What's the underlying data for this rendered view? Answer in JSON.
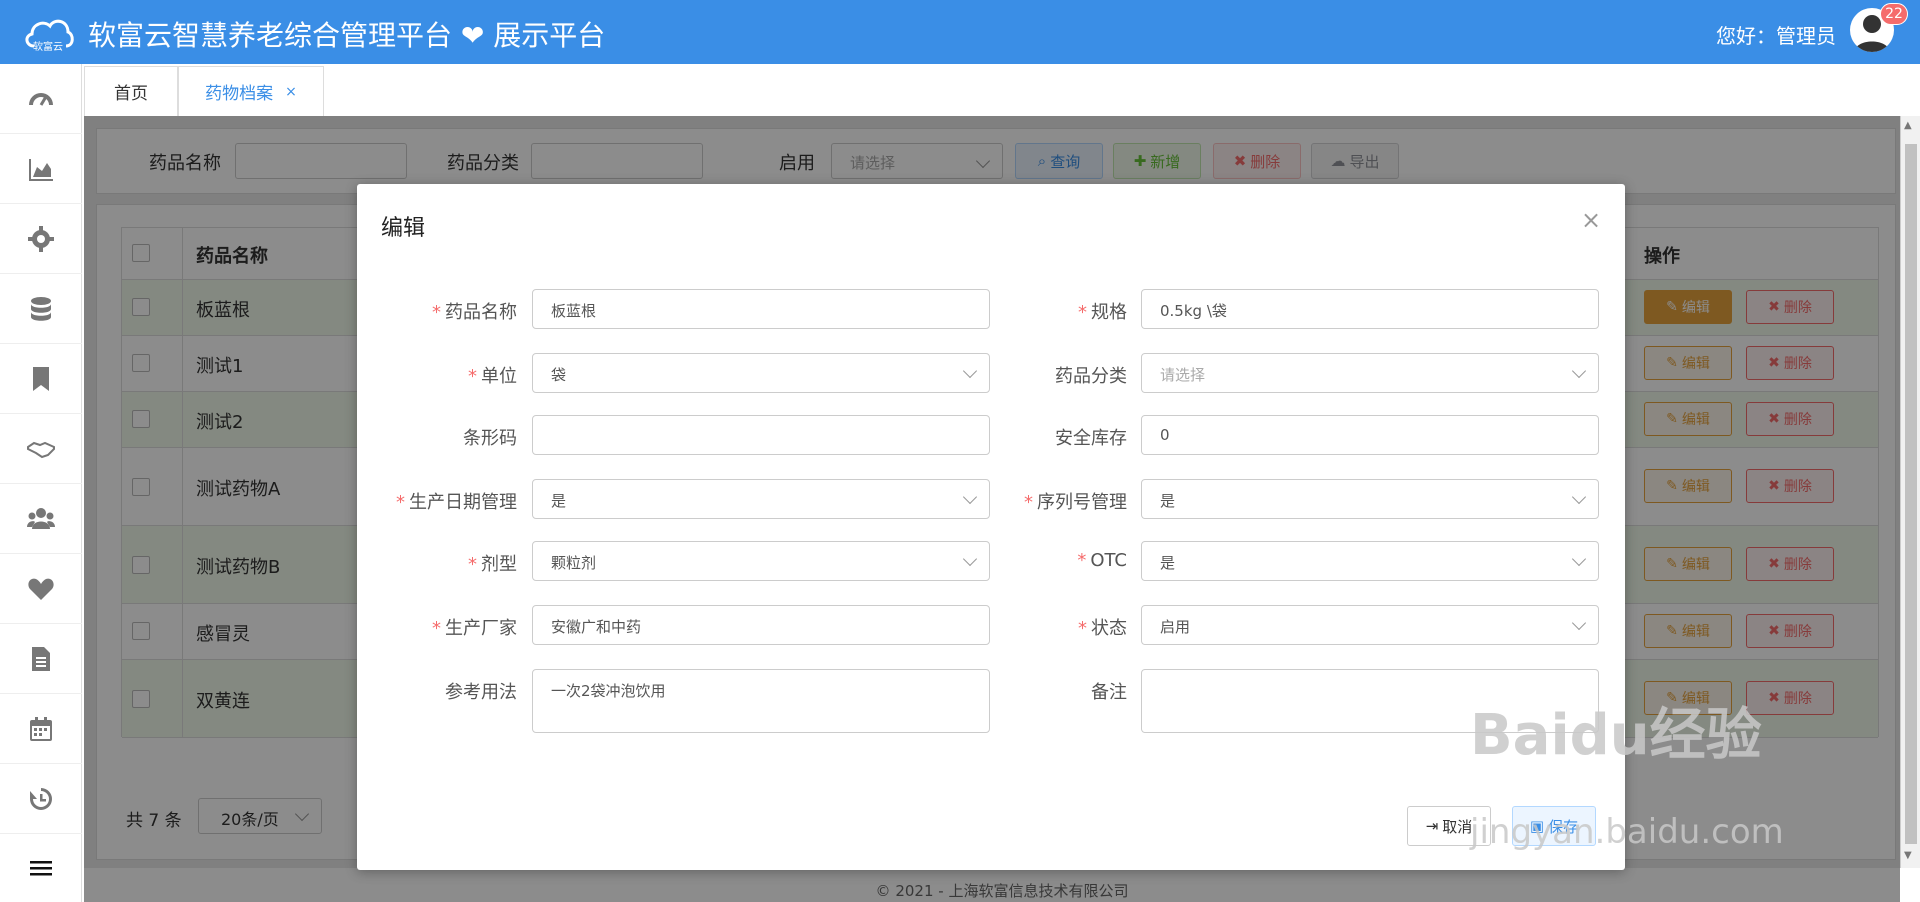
{
  "header": {
    "logo_text": "软富云",
    "title": "软富云智慧养老综合管理平台 ❤ 展示平台",
    "greeting": "您好：管理员",
    "badge": "22"
  },
  "sidebar": {
    "items": [
      "dashboard-icon",
      "chart-icon",
      "gear-icon",
      "database-icon",
      "bookmark-icon",
      "handshake-icon",
      "users-icon",
      "heart-icon",
      "document-icon",
      "calendar-icon",
      "history-icon",
      "menu-toggle-icon"
    ]
  },
  "tabs": [
    {
      "label": "首页"
    },
    {
      "label": "药物档案",
      "close": "×"
    }
  ],
  "search": {
    "name_label": "药品名称",
    "category_label": "药品分类",
    "enabled_label": "启用",
    "enabled_placeholder": "请选择",
    "query_btn": "查询",
    "add_btn": "新增",
    "delete_btn": "删除",
    "export_btn": "导出"
  },
  "table": {
    "header_name": "药品名称",
    "header_ops": "操作",
    "edit_label": "编辑",
    "delete_label": "删除",
    "rows": [
      "板蓝根",
      "测试1",
      "测试2",
      "测试药物A",
      "测试药物B",
      "感冒灵",
      "双黄连"
    ]
  },
  "pagination": {
    "total": "共 7 条",
    "page_size": "20条/页"
  },
  "footer": {
    "copyright": "© 2021 - 上海软富信息技术有限公司"
  },
  "modal": {
    "title": "编辑",
    "close": "×",
    "fields": {
      "drug_name": {
        "label": "药品名称",
        "value": "板蓝根"
      },
      "spec": {
        "label": "规格",
        "value": "0.5kg \\袋"
      },
      "unit": {
        "label": "单位",
        "value": "袋"
      },
      "category": {
        "label": "药品分类",
        "placeholder": "请选择"
      },
      "barcode": {
        "label": "条形码",
        "value": ""
      },
      "safety_stock": {
        "label": "安全库存",
        "value": "0"
      },
      "prod_date_mgmt": {
        "label": "生产日期管理",
        "value": "是"
      },
      "serial_mgmt": {
        "label": "序列号管理",
        "value": "是"
      },
      "dosage_form": {
        "label": "剂型",
        "value": "颗粒剂"
      },
      "otc": {
        "label": "OTC",
        "value": "是"
      },
      "manufacturer": {
        "label": "生产厂家",
        "value": "安徽广和中药"
      },
      "status": {
        "label": "状态",
        "value": "启用"
      },
      "usage": {
        "label": "参考用法",
        "value": "一次2袋冲泡饮用"
      },
      "remark": {
        "label": "备注",
        "value": ""
      }
    },
    "cancel": "取消",
    "save": "保存"
  },
  "watermark": {
    "line1": "Baidu经验",
    "line2": "jingyan.baidu.com"
  }
}
